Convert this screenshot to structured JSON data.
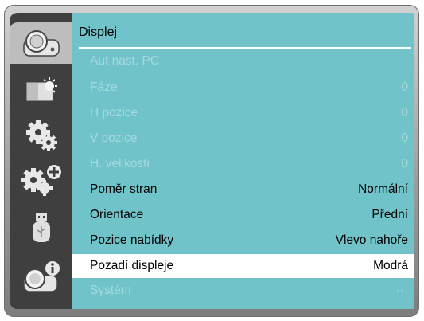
{
  "sidebar": {
    "items": [
      {
        "icon": "projector-icon"
      },
      {
        "icon": "image-adjust-icon"
      },
      {
        "icon": "settings-gear-icon"
      },
      {
        "icon": "advanced-settings-icon"
      },
      {
        "icon": "usb-icon"
      },
      {
        "icon": "information-icon"
      }
    ]
  },
  "panel": {
    "title": "Displej",
    "rows": [
      {
        "label": "Aut nast. PC",
        "value": ""
      },
      {
        "label": "Fáze",
        "value": "0"
      },
      {
        "label": "H pozice",
        "value": "0"
      },
      {
        "label": "V pozice",
        "value": "0"
      },
      {
        "label": "H. velikosti",
        "value": "0"
      },
      {
        "label": "Poměr stran",
        "value": "Normální"
      },
      {
        "label": "Orientace",
        "value": "Přední"
      },
      {
        "label": "Pozice nabídky",
        "value": "Vlevo nahoře"
      },
      {
        "label": "Pozadí displeje",
        "value": "Modrá"
      },
      {
        "label": "Systém",
        "value": "···"
      }
    ]
  },
  "colors": {
    "panel_bg": "#6fc3c9",
    "sidebar_bg": "#3f3f3f",
    "disabled_text": "#a7dadd",
    "selected_bg": "#ffffff"
  }
}
